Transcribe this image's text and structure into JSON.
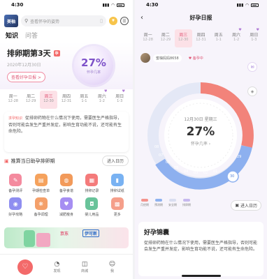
{
  "status_bar": {
    "time": "4:30",
    "signal": "▮▮▮",
    "wifi": "◠"
  },
  "left": {
    "logo_text": "美柚",
    "search_placeholder": "查看怀孕的姿势",
    "coin_label": "¥",
    "tabs": [
      {
        "label": "知识",
        "active": true
      },
      {
        "label": "问答",
        "active": false
      }
    ],
    "phase_title": "排卵期第3天",
    "phase_tag": "孕",
    "date": "2020年12月30日",
    "daily_report_btn": "查看好孕日报 >",
    "bubble_percent": "27%",
    "bubble_label": "怀孕几率",
    "week": [
      {
        "day": "周一",
        "date": "12-28"
      },
      {
        "day": "周二",
        "date": "12-29"
      },
      {
        "day": "周三",
        "date": "12-30",
        "today": true
      },
      {
        "day": "周四",
        "date": "12-31"
      },
      {
        "day": "周五",
        "date": "1-1"
      },
      {
        "day": "周六",
        "date": "1-2"
      },
      {
        "day": "周日",
        "date": "1-3"
      }
    ],
    "tip_tag": "求孕知识",
    "tip_text": "促排卵药物在什么情况下使用，需要医生严格指导，否则可能会发生严重并发症，影响生育功能不说，还可能有生命危险。",
    "push_text": "推算当日助孕排卵期",
    "push_button": "进入日历",
    "grid": [
      {
        "label": "备孕测评",
        "icon": "✎",
        "color": "#f48a9e"
      },
      {
        "label": "孕期检查单",
        "icon": "▤",
        "color": "#f5a25d"
      },
      {
        "label": "备孕食谱",
        "icon": "◍",
        "color": "#f29a5a"
      },
      {
        "label": "排卵记录",
        "icon": "▦",
        "color": "#f47b7b"
      },
      {
        "label": "排卵试纸",
        "icon": "▮",
        "color": "#79b2f2"
      },
      {
        "label": "好孕攻略",
        "icon": "◉",
        "color": "#8f8ef0"
      },
      {
        "label": "备孕调理",
        "icon": "❋",
        "color": "#f4a06a"
      },
      {
        "label": "减肥瘦身",
        "icon": "♥",
        "color": "#a68ef2"
      },
      {
        "label": "婴儿用品",
        "icon": "◘",
        "color": "#69c39a"
      },
      {
        "label": "更多",
        "icon": "▩",
        "color": "#f59f8a"
      }
    ],
    "banner_brand": "京东",
    "banner_brand2": "伊可新",
    "nav": [
      {
        "label": "",
        "icon": "♡"
      },
      {
        "label": "发现",
        "icon": "◔"
      },
      {
        "label": "商城",
        "icon": "◫"
      },
      {
        "label": "我",
        "icon": "☺"
      }
    ]
  },
  "right": {
    "title": "好孕日报",
    "week": [
      {
        "day": "周一",
        "date": "12-28"
      },
      {
        "day": "周二",
        "date": "12-29"
      },
      {
        "day": "周三",
        "date": "12-30",
        "selected": true
      },
      {
        "day": "周四",
        "date": "12-31"
      },
      {
        "day": "周五",
        "date": "1-1"
      },
      {
        "day": "周六",
        "date": "1-2"
      },
      {
        "day": "周日",
        "date": "1-3"
      }
    ],
    "username": "蜜柚妈妈8658",
    "follow_label": "♥ 备孕中",
    "dial_date": "12月30日  星期三",
    "dial_percent": "27%",
    "dial_label": "怀孕几率 ›",
    "dial_days": [
      "08",
      "07",
      "06",
      "05",
      "04",
      "03",
      "02",
      "01",
      "30",
      "29"
    ],
    "legend": [
      {
        "label": "月经期",
        "color": "#f4938d"
      },
      {
        "label": "预测期",
        "color": "#8fb2f0"
      },
      {
        "label": "安全期",
        "color": "#d9def0"
      },
      {
        "label": "排卵期",
        "color": "#c7b9ef"
      }
    ],
    "calendar_button": "进入日历",
    "card_title": "好孕锦囊",
    "card_text": "促排卵药物在什么情况下使用，需要医生严格指导，否则可能会发生严重并发症，影响生育功能不说，还可能有生命危险。"
  }
}
